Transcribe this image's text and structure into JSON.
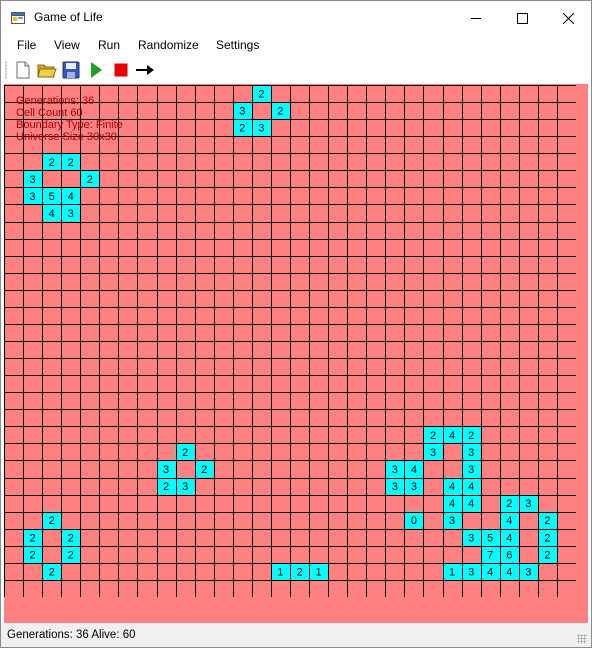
{
  "window": {
    "title": "Game of Life"
  },
  "menu": [
    "File",
    "View",
    "Run",
    "Randomize",
    "Settings"
  ],
  "toolbar": {
    "buttons": [
      {
        "name": "new-file",
        "icon": "new-document-icon"
      },
      {
        "name": "open-file",
        "icon": "open-folder-icon"
      },
      {
        "name": "save-file",
        "icon": "save-disk-icon"
      },
      {
        "name": "start",
        "icon": "play-icon"
      },
      {
        "name": "stop",
        "icon": "stop-icon"
      },
      {
        "name": "next-generation",
        "icon": "arrow-right-icon"
      }
    ]
  },
  "hud": {
    "line1": "Generations: 36",
    "line2": "Cell Count 60",
    "line3": "Boundary Type: Finite",
    "line4": "Universe Size 30x30"
  },
  "universe": {
    "columns": 30,
    "rows": 30,
    "dead_color": "#ff8080",
    "alive_color": "#00ffff",
    "grid_color": "#000000",
    "live_cells": [
      {
        "row": 0,
        "col": 13,
        "n": "2"
      },
      {
        "row": 1,
        "col": 12,
        "n": "3"
      },
      {
        "row": 1,
        "col": 14,
        "n": "2"
      },
      {
        "row": 2,
        "col": 12,
        "n": "2"
      },
      {
        "row": 2,
        "col": 13,
        "n": "3"
      },
      {
        "row": 4,
        "col": 2,
        "n": "2"
      },
      {
        "row": 4,
        "col": 3,
        "n": "2"
      },
      {
        "row": 5,
        "col": 1,
        "n": "3"
      },
      {
        "row": 5,
        "col": 4,
        "n": "2"
      },
      {
        "row": 6,
        "col": 1,
        "n": "3"
      },
      {
        "row": 6,
        "col": 2,
        "n": "5"
      },
      {
        "row": 6,
        "col": 3,
        "n": "4"
      },
      {
        "row": 7,
        "col": 2,
        "n": "4"
      },
      {
        "row": 7,
        "col": 3,
        "n": "3"
      },
      {
        "row": 20,
        "col": 22,
        "n": "2"
      },
      {
        "row": 20,
        "col": 23,
        "n": "4"
      },
      {
        "row": 20,
        "col": 24,
        "n": "2"
      },
      {
        "row": 21,
        "col": 9,
        "n": "2"
      },
      {
        "row": 21,
        "col": 22,
        "n": "3"
      },
      {
        "row": 21,
        "col": 24,
        "n": "3"
      },
      {
        "row": 22,
        "col": 8,
        "n": "3"
      },
      {
        "row": 22,
        "col": 10,
        "n": "2"
      },
      {
        "row": 22,
        "col": 20,
        "n": "3"
      },
      {
        "row": 22,
        "col": 21,
        "n": "4"
      },
      {
        "row": 22,
        "col": 24,
        "n": "3"
      },
      {
        "row": 23,
        "col": 8,
        "n": "2"
      },
      {
        "row": 23,
        "col": 9,
        "n": "3"
      },
      {
        "row": 23,
        "col": 20,
        "n": "3"
      },
      {
        "row": 23,
        "col": 21,
        "n": "3"
      },
      {
        "row": 23,
        "col": 23,
        "n": "4"
      },
      {
        "row": 23,
        "col": 24,
        "n": "4"
      },
      {
        "row": 24,
        "col": 23,
        "n": "4"
      },
      {
        "row": 24,
        "col": 24,
        "n": "4"
      },
      {
        "row": 24,
        "col": 26,
        "n": "2"
      },
      {
        "row": 24,
        "col": 27,
        "n": "3"
      },
      {
        "row": 25,
        "col": 2,
        "n": "2"
      },
      {
        "row": 25,
        "col": 21,
        "n": "0"
      },
      {
        "row": 25,
        "col": 23,
        "n": "3"
      },
      {
        "row": 25,
        "col": 26,
        "n": "4"
      },
      {
        "row": 25,
        "col": 28,
        "n": "2"
      },
      {
        "row": 26,
        "col": 1,
        "n": "2"
      },
      {
        "row": 26,
        "col": 3,
        "n": "2"
      },
      {
        "row": 26,
        "col": 24,
        "n": "3"
      },
      {
        "row": 26,
        "col": 25,
        "n": "5"
      },
      {
        "row": 26,
        "col": 26,
        "n": "4"
      },
      {
        "row": 26,
        "col": 28,
        "n": "2"
      },
      {
        "row": 27,
        "col": 1,
        "n": "2"
      },
      {
        "row": 27,
        "col": 3,
        "n": "2"
      },
      {
        "row": 27,
        "col": 25,
        "n": "7"
      },
      {
        "row": 27,
        "col": 26,
        "n": "6"
      },
      {
        "row": 27,
        "col": 28,
        "n": "2"
      },
      {
        "row": 28,
        "col": 2,
        "n": "2"
      },
      {
        "row": 28,
        "col": 14,
        "n": "1"
      },
      {
        "row": 28,
        "col": 15,
        "n": "2"
      },
      {
        "row": 28,
        "col": 16,
        "n": "1"
      },
      {
        "row": 28,
        "col": 23,
        "n": "1"
      },
      {
        "row": 28,
        "col": 24,
        "n": "3"
      },
      {
        "row": 28,
        "col": 25,
        "n": "4"
      },
      {
        "row": 28,
        "col": 26,
        "n": "4"
      },
      {
        "row": 28,
        "col": 27,
        "n": "3"
      }
    ]
  },
  "status": {
    "text": "Generations: 36 Alive: 60"
  }
}
